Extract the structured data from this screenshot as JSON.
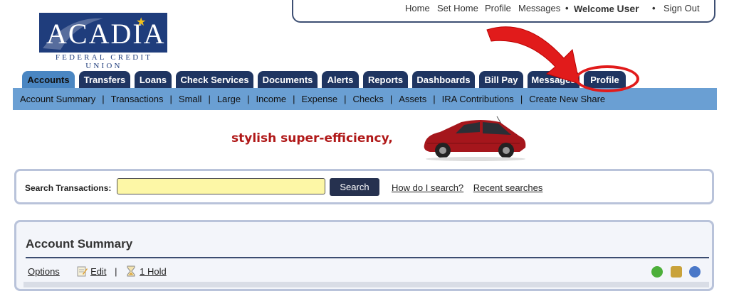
{
  "topnav": {
    "home": "Home",
    "set_home": "Set Home",
    "profile": "Profile",
    "messages": "Messages",
    "welcome": "Welcome",
    "user": "User",
    "sign_out": "Sign Out"
  },
  "logo": {
    "name": "ACADIA",
    "subtitle": "FEDERAL CREDIT UNION"
  },
  "tabs": [
    {
      "label": "Accounts",
      "active": true
    },
    {
      "label": "Transfers"
    },
    {
      "label": "Loans"
    },
    {
      "label": "Check Services"
    },
    {
      "label": "Documents"
    },
    {
      "label": "Alerts"
    },
    {
      "label": "Reports"
    },
    {
      "label": "Dashboards"
    },
    {
      "label": "Bill Pay"
    },
    {
      "label": "Messages"
    },
    {
      "label": "Profile"
    }
  ],
  "subnav": [
    "Account Summary",
    "Transactions",
    "Small",
    "Large",
    "Income",
    "Expense",
    "Checks",
    "Assets",
    "IRA Contributions",
    "Create New Share"
  ],
  "subnav_separator": "|",
  "banner": {
    "text": "stylish super-efficiency,"
  },
  "search": {
    "label": "Search Transactions:",
    "value": "",
    "button": "Search",
    "help_link": "How do I search?",
    "recent_link": "Recent searches"
  },
  "account_summary": {
    "title": "Account Summary",
    "options": "Options",
    "edit": "Edit",
    "separator": "|",
    "hold": "1 Hold"
  },
  "colors": {
    "tab_bg": "#1f3561",
    "active_tab_bg": "#4a86c2",
    "subnav_bg": "#6a9fd3",
    "annotation": "#e11b1b",
    "banner_text": "#b01818",
    "search_input_bg": "#fdf7a6"
  }
}
